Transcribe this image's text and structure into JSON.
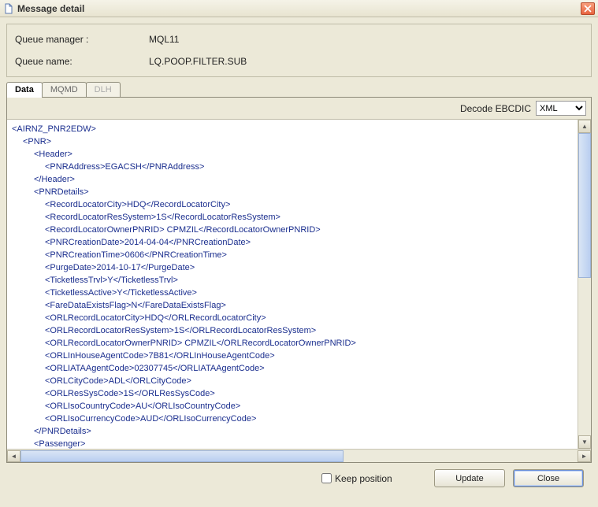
{
  "window": {
    "title": "Message detail"
  },
  "info": {
    "queue_manager_label": "Queue manager :",
    "queue_manager_value": "MQL11",
    "queue_name_label": "Queue name:",
    "queue_name_value": "LQ.POOP.FILTER.SUB"
  },
  "tabs": {
    "data": "Data",
    "mqmd": "MQMD",
    "dlh": "DLH"
  },
  "toolbar": {
    "decode_label": "Decode EBCDIC",
    "decode_selected": "XML"
  },
  "xml": [
    {
      "indent": 0,
      "text": "<AIRNZ_PNR2EDW>"
    },
    {
      "indent": 1,
      "text": "<PNR>"
    },
    {
      "indent": 2,
      "text": "<Header>"
    },
    {
      "indent": 3,
      "text": "<PNRAddress>EGACSH</PNRAddress>"
    },
    {
      "indent": 2,
      "text": "</Header>"
    },
    {
      "indent": 2,
      "text": "<PNRDetails>"
    },
    {
      "indent": 3,
      "text": "<RecordLocatorCity>HDQ</RecordLocatorCity>"
    },
    {
      "indent": 3,
      "text": "<RecordLocatorResSystem>1S</RecordLocatorResSystem>"
    },
    {
      "indent": 3,
      "text": "<RecordLocatorOwnerPNRID>  CPMZIL</RecordLocatorOwnerPNRID>"
    },
    {
      "indent": 3,
      "text": "<PNRCreationDate>2014-04-04</PNRCreationDate>"
    },
    {
      "indent": 3,
      "text": "<PNRCreationTime>0606</PNRCreationTime>"
    },
    {
      "indent": 3,
      "text": "<PurgeDate>2014-10-17</PurgeDate>"
    },
    {
      "indent": 3,
      "text": "<TicketlessTrvl>Y</TicketlessTrvl>"
    },
    {
      "indent": 3,
      "text": "<TicketlessActive>Y</TicketlessActive>"
    },
    {
      "indent": 3,
      "text": "<FareDataExistsFlag>N</FareDataExistsFlag>"
    },
    {
      "indent": 3,
      "text": "<ORLRecordLocatorCity>HDQ</ORLRecordLocatorCity>"
    },
    {
      "indent": 3,
      "text": "<ORLRecordLocatorResSystem>1S</ORLRecordLocatorResSystem>"
    },
    {
      "indent": 3,
      "text": "<ORLRecordLocatorOwnerPNRID>  CPMZIL</ORLRecordLocatorOwnerPNRID>"
    },
    {
      "indent": 3,
      "text": "<ORLInHouseAgentCode>7B81</ORLInHouseAgentCode>"
    },
    {
      "indent": 3,
      "text": "<ORLIATAAgentCode>02307745</ORLIATAAgentCode>"
    },
    {
      "indent": 3,
      "text": "<ORLCityCode>ADL</ORLCityCode>"
    },
    {
      "indent": 3,
      "text": "<ORLResSysCode>1S</ORLResSysCode>"
    },
    {
      "indent": 3,
      "text": "<ORLIsoCountryCode>AU</ORLIsoCountryCode>"
    },
    {
      "indent": 3,
      "text": "<ORLIsoCurrencyCode>AUD</ORLIsoCurrencyCode>"
    },
    {
      "indent": 2,
      "text": "</PNRDetails>"
    },
    {
      "indent": 2,
      "text": "<Passenger>"
    }
  ],
  "bottom": {
    "keep_position_label": "Keep position",
    "update_label": "Update",
    "close_label": "Close"
  }
}
